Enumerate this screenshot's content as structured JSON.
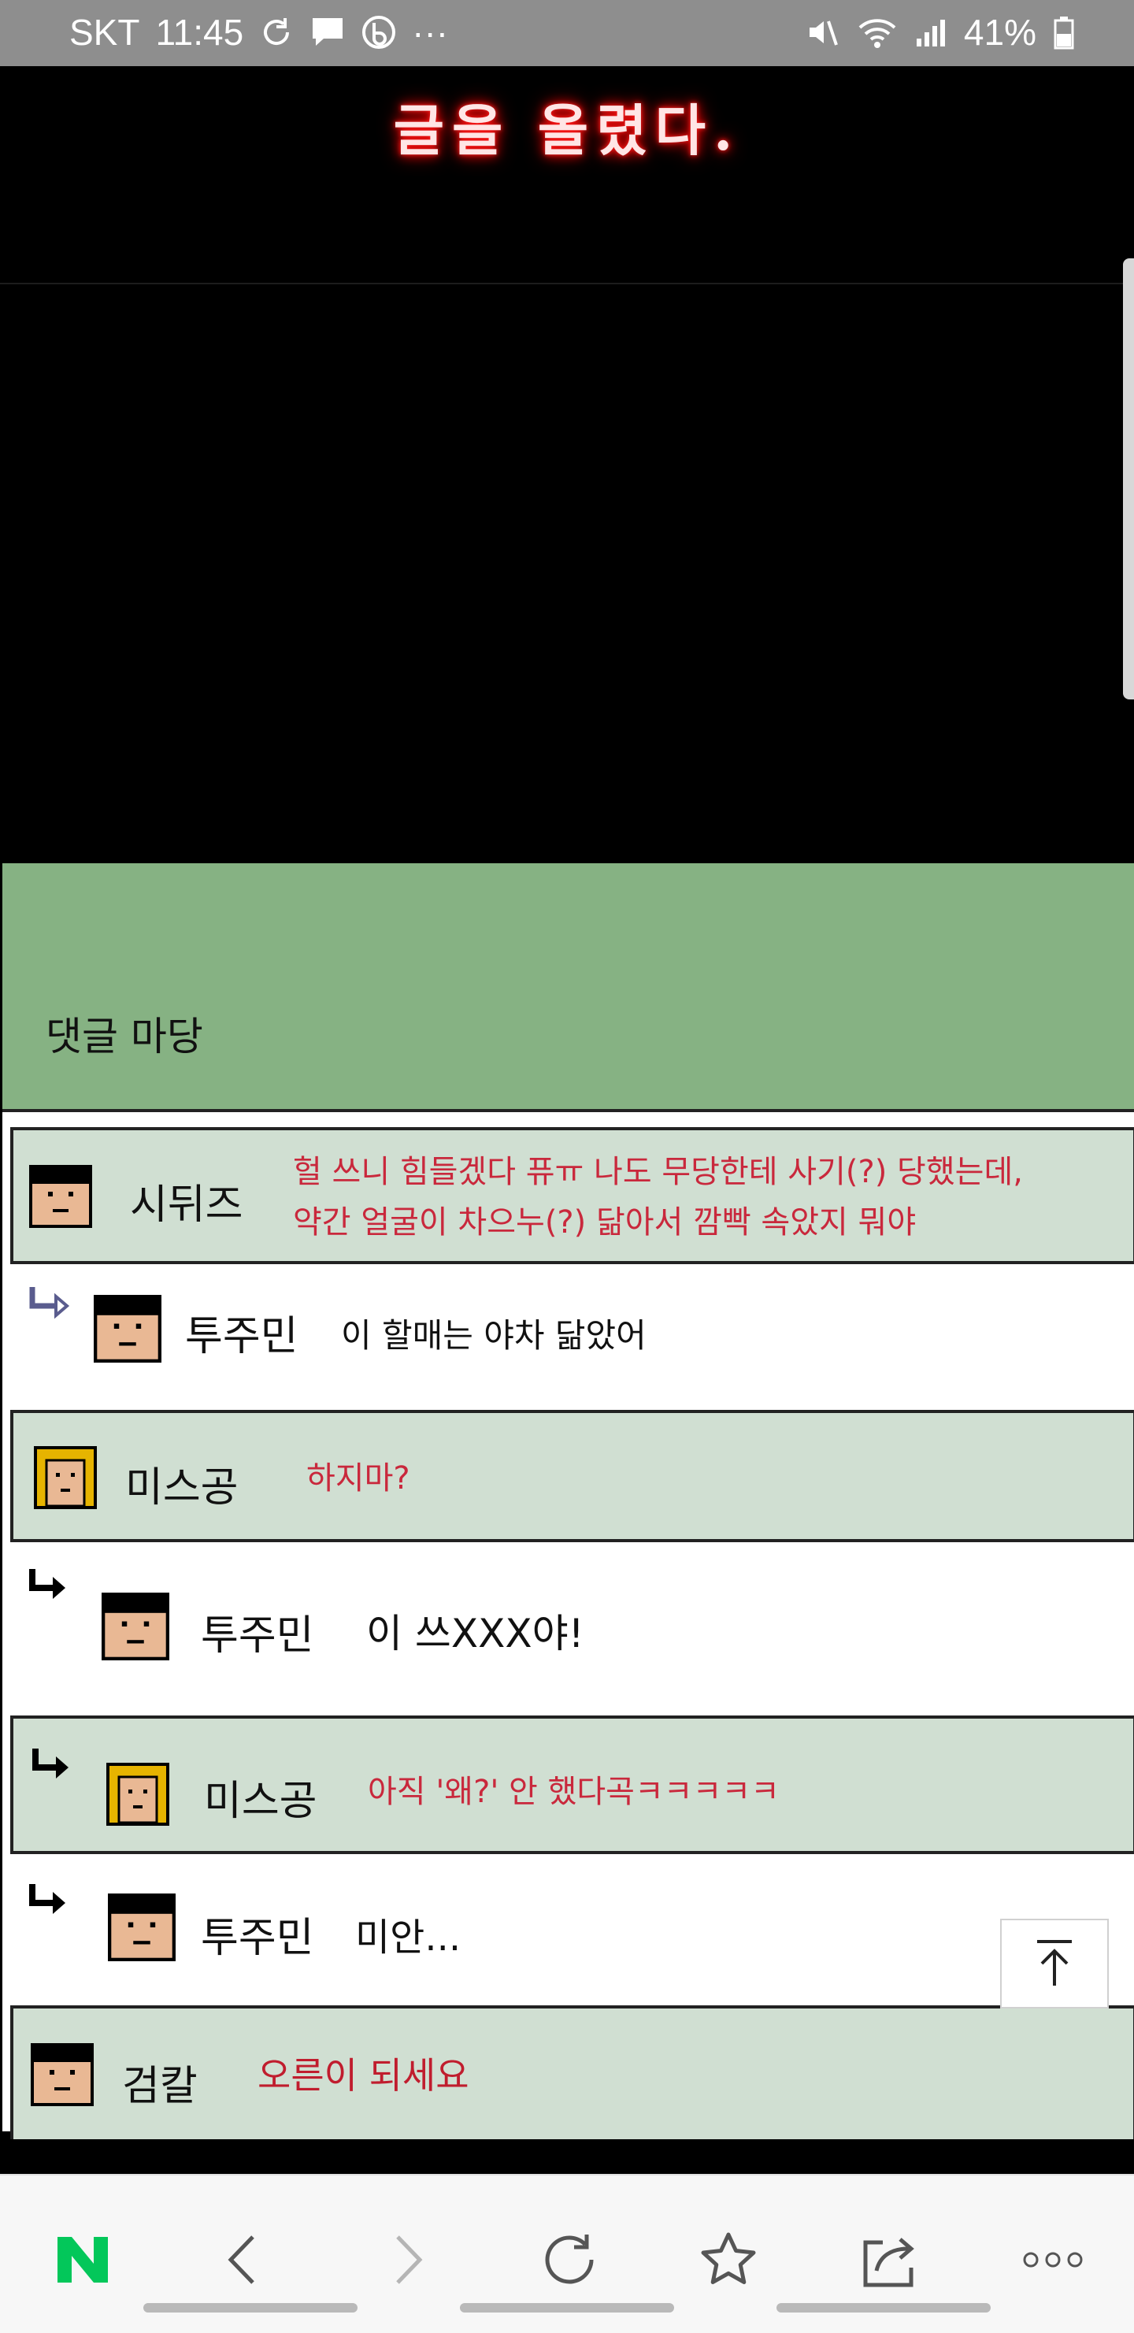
{
  "status_bar": {
    "carrier": "SKT",
    "time": "11:45",
    "dots": "···",
    "battery": "41%"
  },
  "post": {
    "title": "글을 올렸다."
  },
  "comments_section": {
    "title": "댓글 마당",
    "comments": [
      {
        "name": "시뒤즈",
        "text_line1": "헐 쓰니 힘들겠다 퓨ㅠ 나도 무당한테 사기(?) 당했는데,",
        "text_line2": "약간 얼굴이 차으누(?) 닮아서 깜빡 속았지 뭐야"
      },
      {
        "name": "투주민",
        "text": "이 할매는 야차 닮았어"
      },
      {
        "name": "미스공",
        "text": "하지마?"
      },
      {
        "name": "투주민",
        "text": "이 쓰XXX야!"
      },
      {
        "name": "미스공",
        "text": "아직 '왜?' 안 했다곡ㅋㅋㅋㅋㅋ"
      },
      {
        "name": "투주민",
        "text": "미안..."
      },
      {
        "name": "검칼",
        "text": "오른이 되세요"
      }
    ]
  },
  "colors": {
    "header_green": "#86b283",
    "row_shade": "#d0dfd2",
    "comment_red": "#c9283c"
  }
}
